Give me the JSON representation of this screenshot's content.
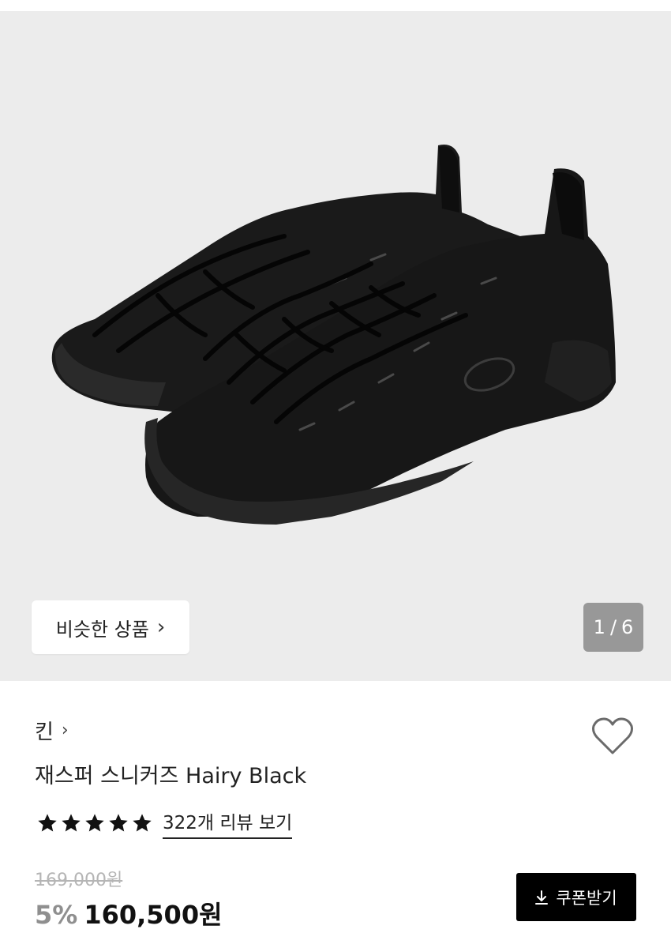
{
  "gallery": {
    "similar_label": "비슷한 상품",
    "similar_icon": "chevron-right-icon",
    "counter_current": "1",
    "counter_sep": "/",
    "counter_total": "6"
  },
  "product": {
    "brand": "킨",
    "brand_icon": "chevron-right-icon",
    "name": "재스퍼 스니커즈 Hairy Black",
    "rating_stars": 5,
    "review_link": "322개 리뷰 보기",
    "original_price": "169,000원",
    "discount": "5%",
    "price": "160,500원",
    "wishlist_icon": "heart-outline-icon"
  },
  "coupon": {
    "label": "쿠폰받기",
    "icon": "download-icon"
  },
  "colors": {
    "gallery_bg": "#ececec",
    "button_dark": "#000000",
    "discount_gray": "#8f8f8f",
    "strike_gray": "#b5b5b5"
  }
}
